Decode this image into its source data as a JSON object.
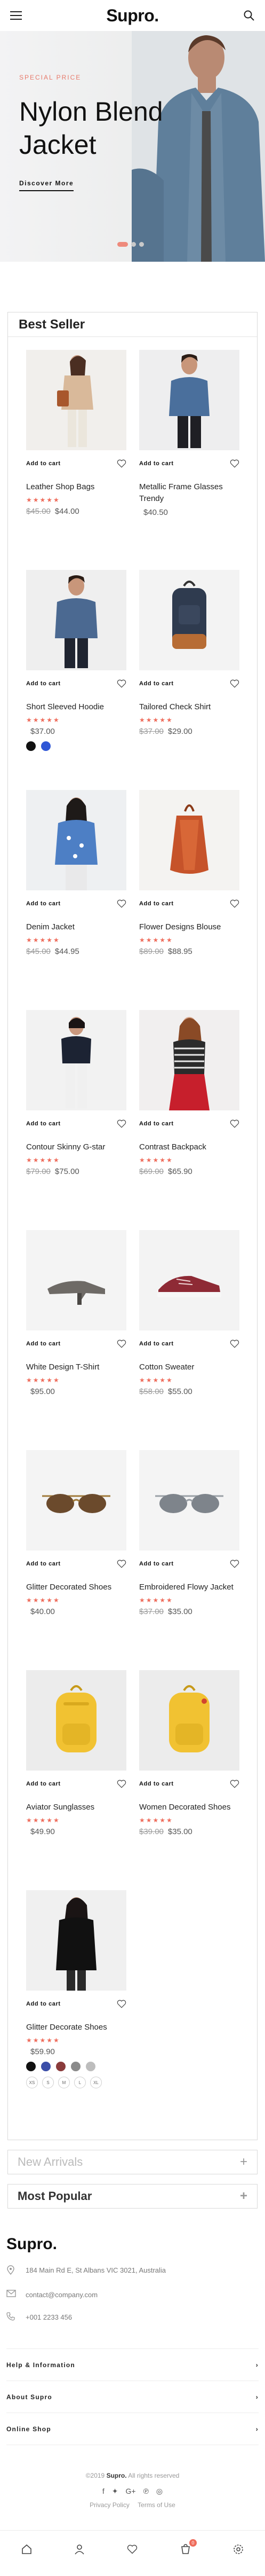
{
  "brand": {
    "name": "Supro.",
    "accent": "#ef6c5b"
  },
  "header": {
    "menu_icon": "hamburger-icon",
    "search_icon": "search-icon"
  },
  "hero": {
    "eyebrow": "Special Price",
    "title": "Nylon Blend Jacket",
    "cta": "Discover More",
    "slides": 3,
    "active_slide": 1
  },
  "best_seller": {
    "title": "Best Seller",
    "add_to_cart": "Add to cart",
    "products": [
      {
        "name": "Leather Shop Bags",
        "rating": "★★★★★",
        "old_price": "$45.00",
        "price": "$44.00"
      },
      {
        "name": "Metallic Frame Glasses Trendy",
        "rating": "",
        "old_price": "",
        "price": "$40.50"
      },
      {
        "name": "Short Sleeved Hoodie",
        "rating": "★★★★★",
        "old_price": "",
        "price": "$37.00"
      },
      {
        "name": "Tailored Check Shirt",
        "rating": "★★★★★",
        "old_price": "$37.00",
        "price": "$29.00"
      },
      {
        "name": "Denim Jacket",
        "rating": "★★★★★",
        "old_price": "$45.00",
        "price": "$44.95"
      },
      {
        "name": "Flower Designs Blouse",
        "rating": "★★★★★",
        "old_price": "$89.00",
        "price": "$88.95"
      },
      {
        "name": "Contour Skinny G-star",
        "rating": "★★★★★",
        "old_price": "$79.00",
        "price": "$75.00"
      },
      {
        "name": "Contrast Backpack",
        "rating": "★★★★★",
        "old_price": "$69.00",
        "price": "$65.90"
      },
      {
        "name": "White Design T-Shirt",
        "rating": "★★★★★",
        "old_price": "",
        "price": "$95.00"
      },
      {
        "name": "Cotton Sweater",
        "rating": "★★★★★",
        "old_price": "$58.00",
        "price": "$55.00"
      },
      {
        "name": "Glitter Decorated Shoes",
        "rating": "★★★★★",
        "old_price": "",
        "price": "$40.00"
      },
      {
        "name": "Embroidered Flowy Jacket",
        "rating": "★★★★★",
        "old_price": "$37.00",
        "price": "$35.00"
      },
      {
        "name": "Aviator Sunglasses",
        "rating": "★★★★★",
        "old_price": "",
        "price": "$49.90"
      },
      {
        "name": "Women Decorated Shoes",
        "rating": "★★★★★",
        "old_price": "$39.00",
        "price": "$35.00"
      },
      {
        "name": "Glitter Decorate Shoes",
        "rating": "★★★★★",
        "old_price": "",
        "price": "$59.90"
      }
    ],
    "swatches_a": [
      "#111111",
      "#2f57d6"
    ],
    "swatches_b": [
      "#111111",
      "#3b4ea8",
      "#8a3b3b",
      "#8a8a8a",
      "#bdbdbd"
    ],
    "sizes": [
      "XS",
      "S",
      "M",
      "L",
      "XL"
    ]
  },
  "sections": {
    "new_arrivals": "New Arrivals",
    "most_popular": "Most Popular",
    "expand_icon": "plus-icon"
  },
  "footer": {
    "logo": "Supro.",
    "address": "184 Main Rd E, St Albans VIC 3021, Australia",
    "email": "contact@company.com",
    "phone": "+001 2233 456",
    "links": [
      "Help & Information",
      "About Supro",
      "Online Shop"
    ],
    "copyright_year": "©2019",
    "copyright_brand": "Supro.",
    "copyright_rest": "All rights reserved",
    "privacy": "Privacy Policy",
    "terms": "Terms of Use"
  },
  "tabbar": {
    "cart_count": "0"
  }
}
